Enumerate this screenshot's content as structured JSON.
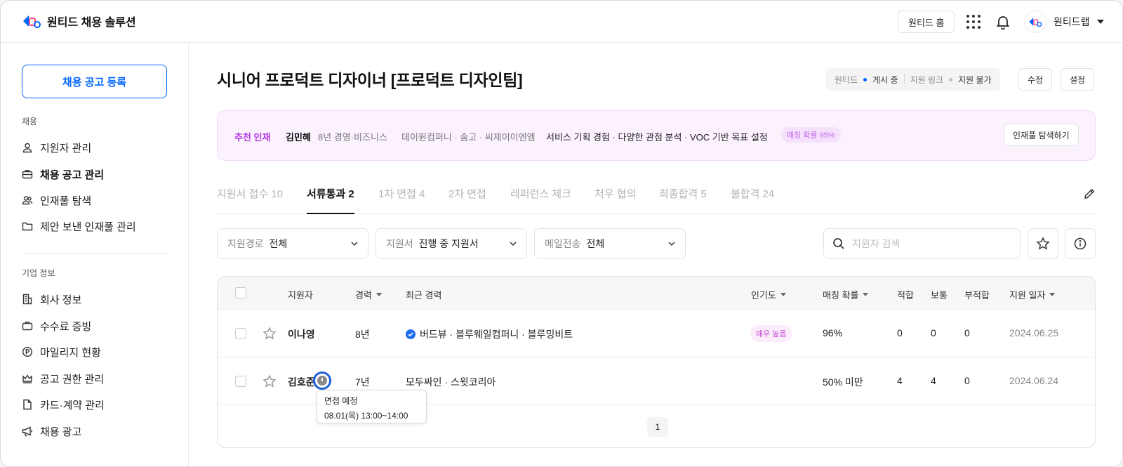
{
  "header": {
    "brand": "원티드 채용 솔루션",
    "home_button": "원티드 홈",
    "company": "원티드랩"
  },
  "sidebar": {
    "post_button": "채용 공고 등록",
    "section1": "채용",
    "items1": [
      {
        "label": "지원자 관리",
        "icon": "person-icon"
      },
      {
        "label": "채용 공고 관리",
        "icon": "briefcase-icon"
      },
      {
        "label": "인재풀 탐색",
        "icon": "people-icon"
      },
      {
        "label": "제안 보낸 인재풀 관리",
        "icon": "folder-icon"
      }
    ],
    "section2": "기업 정보",
    "items2": [
      {
        "label": "회사 정보",
        "icon": "building-icon"
      },
      {
        "label": "수수료 증빙",
        "icon": "receipt-icon"
      },
      {
        "label": "마일리지 현황",
        "icon": "coin-icon"
      },
      {
        "label": "공고 권한 관리",
        "icon": "crown-icon"
      },
      {
        "label": "카드·계약 관리",
        "icon": "document-icon"
      },
      {
        "label": "채용 광고",
        "icon": "megaphone-icon"
      }
    ]
  },
  "job": {
    "title": "시니어 프로덕트 디자이너 [프로덕트 디자인팀]",
    "status": {
      "wanted_label": "원티드",
      "wanted_value": "게시 중",
      "link_label": "지원 링크",
      "link_value": "지원 불가"
    },
    "edit_button": "수정",
    "settings_button": "설정"
  },
  "recommend": {
    "label": "추천 인재",
    "name": "김민혜",
    "career": "8년 경영·비즈니스",
    "companies": "데이원컴퍼니 · 숨고 · 씨제이이엔엠",
    "skills": "서비스 기획 경험 · 다양한 관점 분석 · VOC 기반 목표 설정",
    "badge": "매칭 확률 95%",
    "button": "인재풀 탐색하기"
  },
  "tabs": [
    {
      "label": "지원서 접수 10"
    },
    {
      "label": "서류통과 2",
      "active": true
    },
    {
      "label": "1차 면접 4"
    },
    {
      "label": "2차 면접"
    },
    {
      "label": "레퍼런스 체크"
    },
    {
      "label": "처우 협의"
    },
    {
      "label": "최종합격 5"
    },
    {
      "label": "불합격 24"
    }
  ],
  "filters": [
    {
      "label": "지원경로",
      "value": "전체"
    },
    {
      "label": "지원서",
      "value": "진행 중 지원서"
    },
    {
      "label": "메일전송",
      "value": "전체"
    }
  ],
  "search": {
    "placeholder": "지원자 검색"
  },
  "table": {
    "headers": [
      "지원자",
      "경력",
      "최근 경력",
      "인기도",
      "매칭 확률",
      "적합",
      "보통",
      "부적합",
      "지원 일자"
    ],
    "rows": [
      {
        "name": "이나영",
        "career": "8년",
        "recent": "버드뷰 · 블루웨일컴퍼니 · 블루밍비트",
        "popularity": "매우 높음",
        "match": "96%",
        "fit": "0",
        "normal": "0",
        "unfit": "0",
        "date": "2024.06.25"
      },
      {
        "name": "김호준",
        "career": "7년",
        "recent": "모두싸인 · 스윗코리아",
        "popularity": "",
        "match": "50% 미만",
        "fit": "4",
        "normal": "4",
        "unfit": "0",
        "date": "2024.06.24"
      }
    ],
    "page": "1"
  },
  "tooltip": {
    "title": "면접 예정",
    "time": "08.01(목) 13:00~14:00"
  },
  "colors": {
    "accent": "#0066ff",
    "recommend": "#b437e6",
    "status_dot_active": "#0066ff",
    "status_dot_inactive": "#c0c0c0"
  }
}
